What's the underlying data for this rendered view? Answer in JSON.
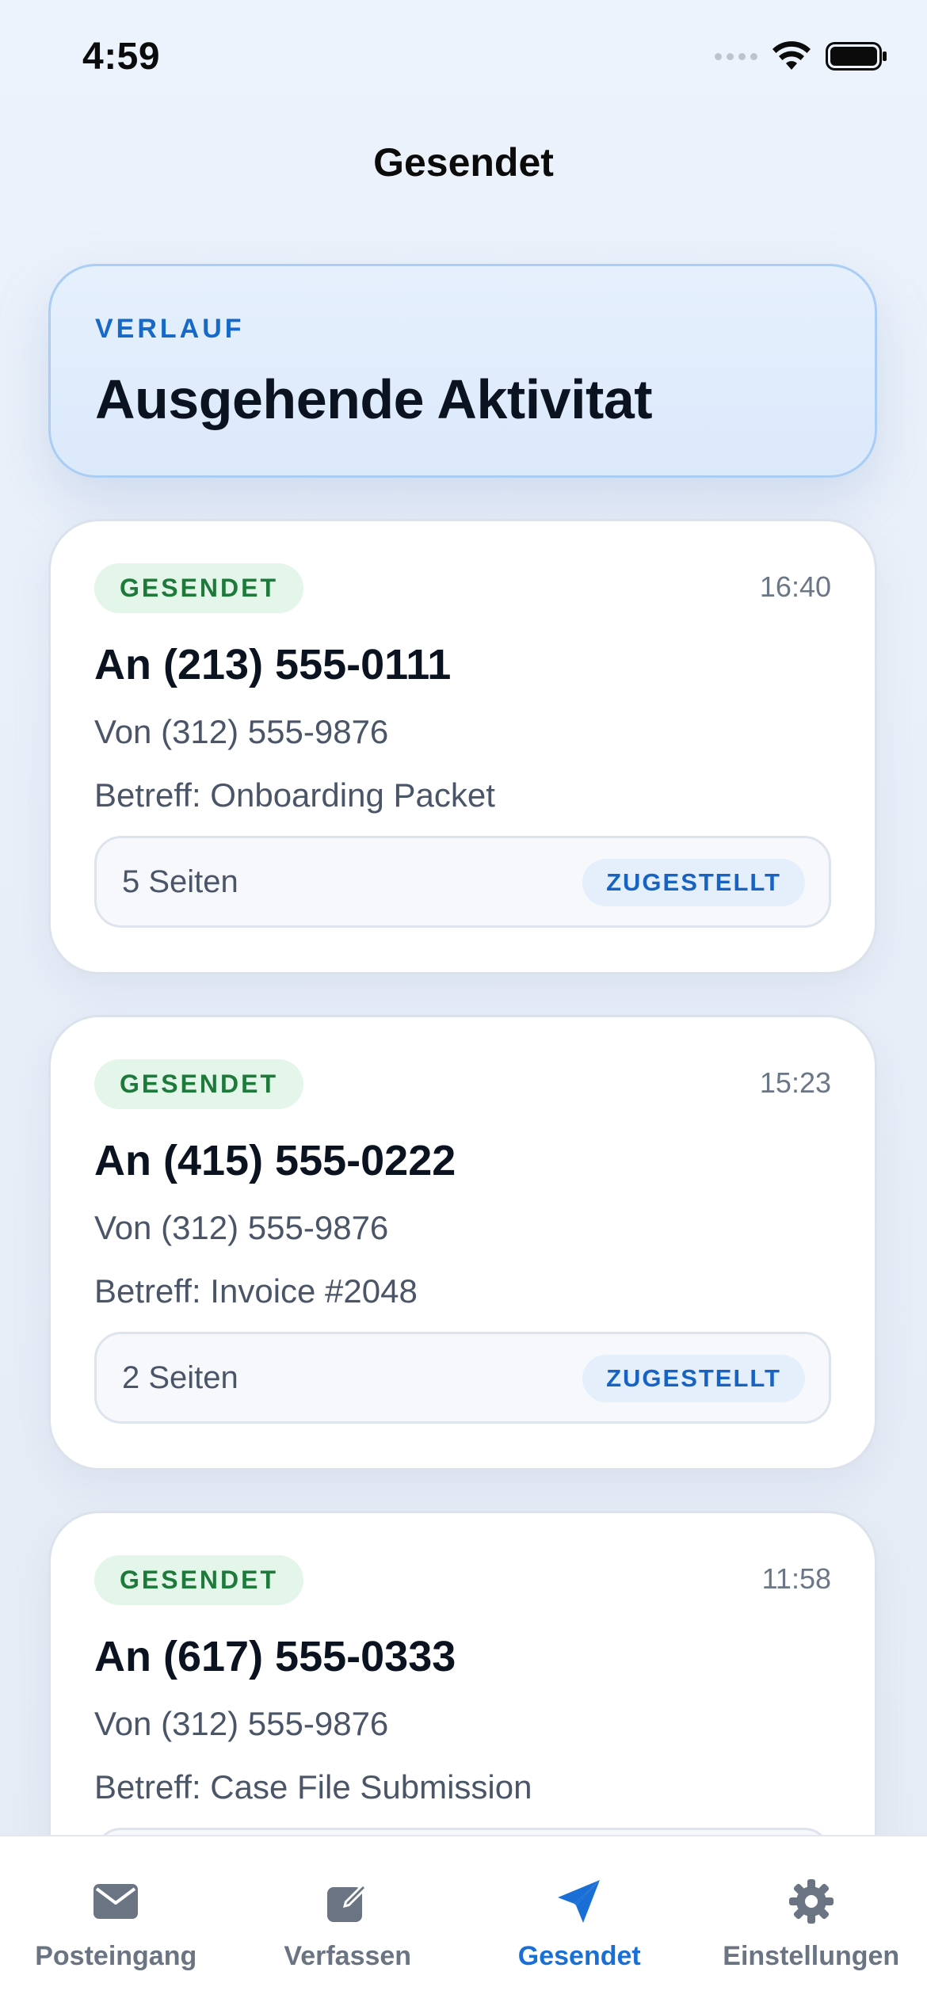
{
  "status_bar": {
    "time": "4:59",
    "signal_icon": "signal-icon",
    "wifi_icon": "wifi-icon",
    "battery_icon": "battery-icon"
  },
  "nav": {
    "title": "Gesendet"
  },
  "hero": {
    "eyebrow": "VERLAUF",
    "title": "Ausgehende Aktivitat"
  },
  "faxes": [
    {
      "status": "GESENDET",
      "time": "16:40",
      "to": "An (213) 555-0111",
      "from": "Von (312) 555-9876",
      "subject": "Betreff: Onboarding Packet",
      "pages": "5 Seiten",
      "delivery": "ZUGESTELLT"
    },
    {
      "status": "GESENDET",
      "time": "15:23",
      "to": "An (415) 555-0222",
      "from": "Von (312) 555-9876",
      "subject": "Betreff: Invoice #2048",
      "pages": "2 Seiten",
      "delivery": "ZUGESTELLT"
    },
    {
      "status": "GESENDET",
      "time": "11:58",
      "to": "An (617) 555-0333",
      "from": "Von (312) 555-9876",
      "subject": "Betreff: Case File Submission",
      "pages": "",
      "delivery": ""
    }
  ],
  "tab_bar": {
    "items": [
      {
        "label": "Posteingang",
        "icon": "envelope-icon",
        "active": false
      },
      {
        "label": "Verfassen",
        "icon": "compose-icon",
        "active": false
      },
      {
        "label": "Gesendet",
        "icon": "paper-plane-icon",
        "active": true
      },
      {
        "label": "Einstellungen",
        "icon": "gear-icon",
        "active": false
      }
    ]
  },
  "colors": {
    "accent": "#1a6fd6",
    "sent_badge_bg": "#e4f5ea",
    "sent_badge_text": "#1d7a3a",
    "delivered_badge_bg": "#e5effc",
    "delivered_badge_text": "#1763c4",
    "tab_inactive": "#6b7482"
  }
}
